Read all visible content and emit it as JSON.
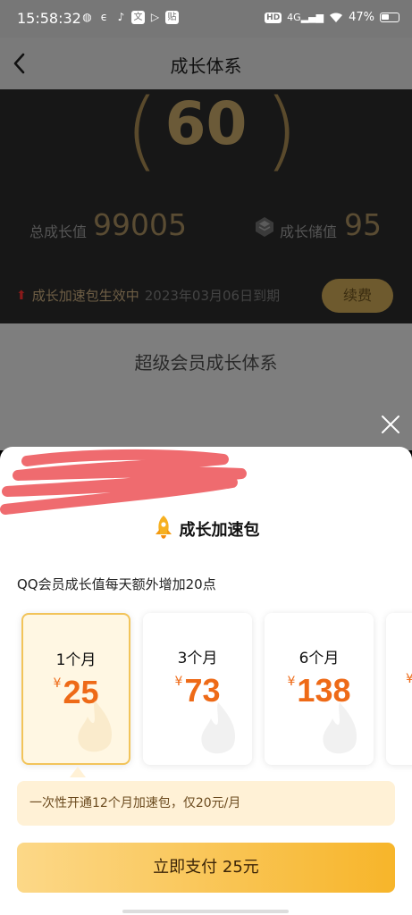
{
  "status_bar": {
    "time": "15:58:32",
    "app_icons": [
      "wechat-icon",
      "telecom-icon",
      "tiktok-icon",
      "wenku-icon",
      "video-icon",
      "tie-icon"
    ],
    "network": "4G",
    "battery": "47%"
  },
  "header": {
    "title": "成长体系"
  },
  "hero": {
    "level": "60",
    "total_growth_label": "总成长值",
    "total_growth_value": "99005",
    "storage_label": "成长储值",
    "storage_value": "95",
    "boost_active_text": "成长加速包生效中",
    "boost_expire_text": "2023年03月06日到期",
    "renew_label": "续费"
  },
  "section": {
    "title": "超级会员成长体系"
  },
  "sheet": {
    "title": "成长加速包",
    "description": "QQ会员成长值每天额外增加20点",
    "currency": "¥",
    "plans": [
      {
        "duration": "1个月",
        "price": "25",
        "selected": true
      },
      {
        "duration": "3个月",
        "price": "73",
        "selected": false
      },
      {
        "duration": "6个月",
        "price": "138",
        "selected": false
      }
    ],
    "annual_tip": "一次性开通12个月加速包，仅20元/月",
    "pay_button": "立即支付 25元"
  },
  "colors": {
    "accent_orange": "#ee6a17",
    "gold_button": "#f7b52a",
    "selected_border": "#f2c45a"
  }
}
